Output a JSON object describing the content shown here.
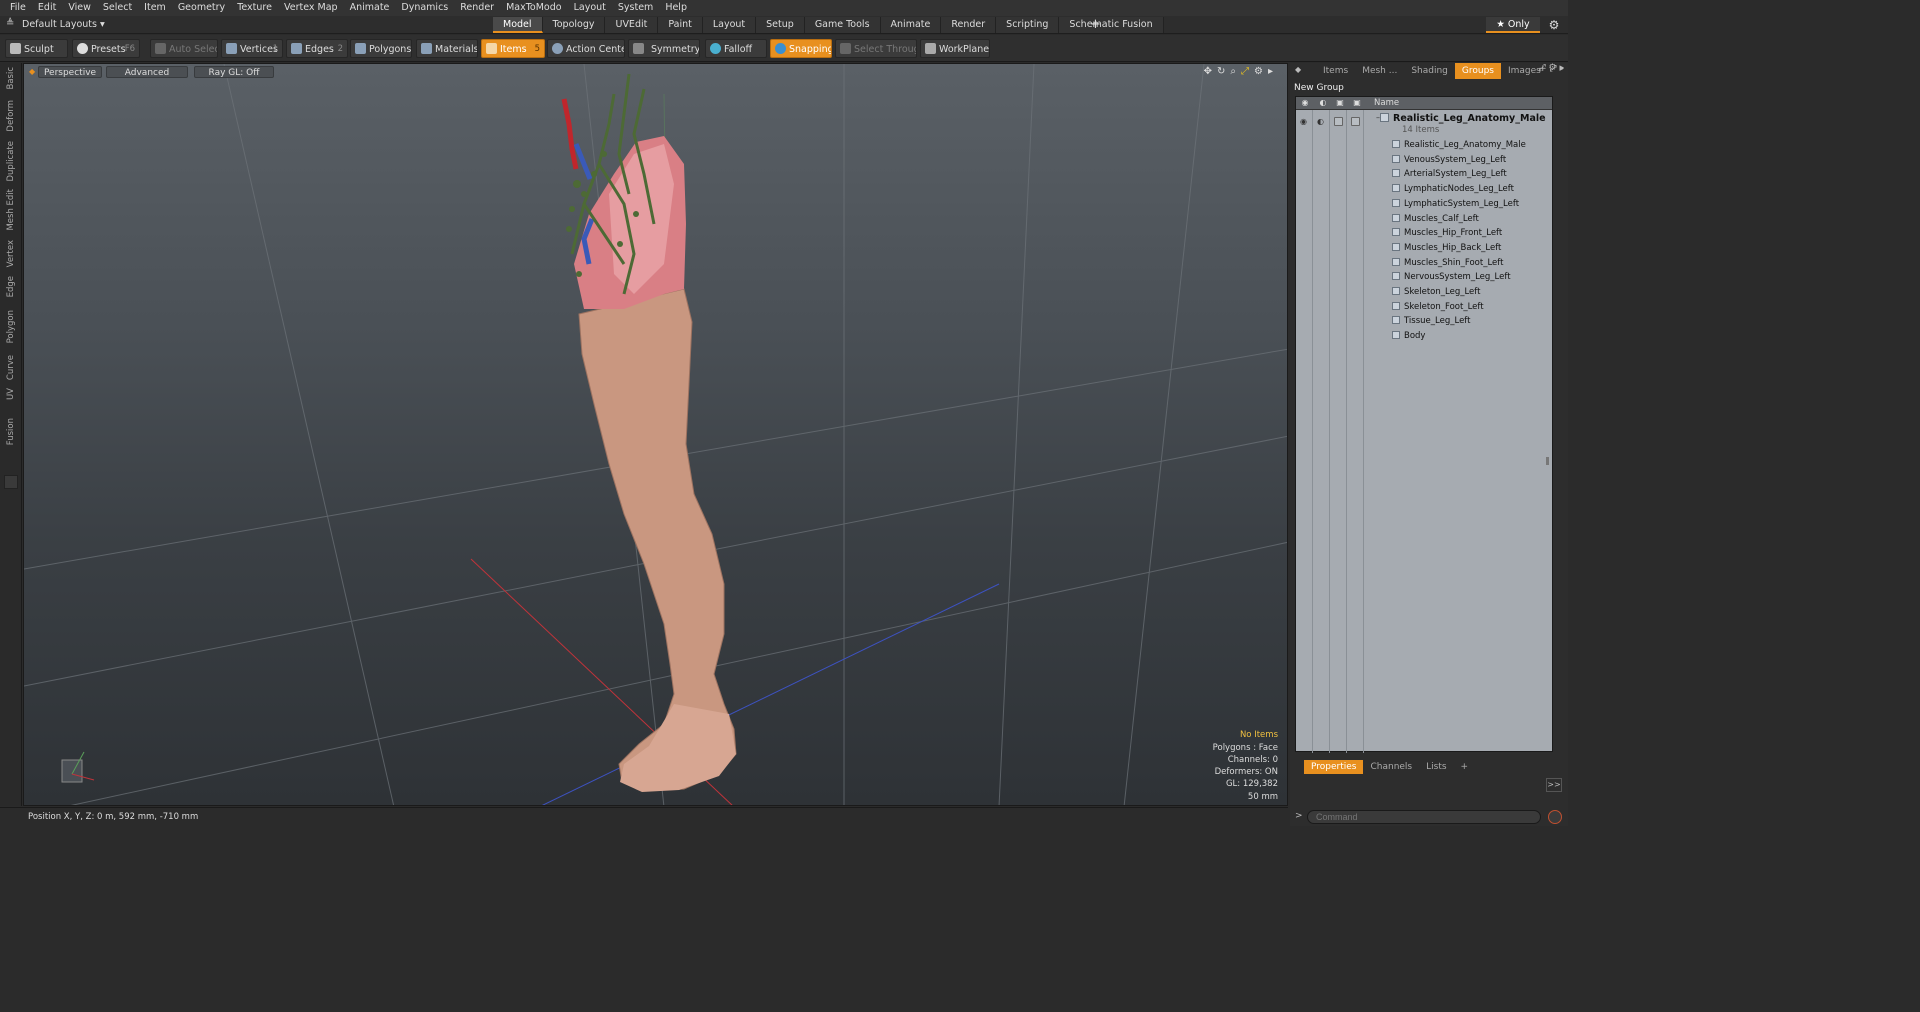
{
  "menu": [
    "File",
    "Edit",
    "View",
    "Select",
    "Item",
    "Geometry",
    "Texture",
    "Vertex Map",
    "Animate",
    "Dynamics",
    "Render",
    "MaxToModo",
    "Layout",
    "System",
    "Help"
  ],
  "layout_selector": "Default Layouts ▾",
  "layout_tabs": [
    "Model",
    "Topology",
    "UVEdit",
    "Paint",
    "Layout",
    "Setup",
    "Game Tools",
    "Animate",
    "Render",
    "Scripting",
    "Schematic Fusion"
  ],
  "layout_tab_active": "Model",
  "only_button": "★  Only",
  "toolbar": {
    "sculpt": "Sculpt",
    "presets": "Presets",
    "presets_key": "F6",
    "auto_select": "Auto Select",
    "vertices": "Vertices",
    "vertices_key": "1",
    "edges": "Edges",
    "edges_key": "2",
    "polygons": "Polygons",
    "materials": "Materials",
    "items": "Items",
    "items_key": "5",
    "action_center": "Action Center",
    "symmetry": "Symmetry",
    "falloff": "Falloff",
    "snapping": "Snapping",
    "select_through": "Select Through",
    "workplane": "WorkPlane"
  },
  "side_tabs": [
    "Basic",
    "Deform",
    "Duplicate",
    "Mesh Edit",
    "Vertex",
    "Edge",
    "Polygon",
    "Curve",
    "UV",
    "Fusion"
  ],
  "viewport": {
    "view_mode": "Perspective",
    "shading": "Advanced",
    "raygl": "Ray GL: Off",
    "info": {
      "items": "No Items",
      "polygons": "Polygons : Face",
      "channels": "Channels: 0",
      "deformers": "Deformers: ON",
      "gl": "GL: 129,382",
      "scale": "50 mm"
    }
  },
  "status": "Position X, Y, Z:   0 m, 592 mm, -710 mm",
  "right_panel": {
    "tabs": [
      "Items",
      "Mesh ...",
      "Shading",
      "Groups",
      "Images"
    ],
    "active_tab": "Groups",
    "new_group": "New Group",
    "column_name": "Name",
    "group_name": "Realistic_Leg_Anatomy_Male",
    "group_count": "14 Items",
    "items": [
      "Realistic_Leg_Anatomy_Male",
      "VenousSystem_Leg_Left",
      "ArterialSystem_Leg_Left",
      "LymphaticNodes_Leg_Left",
      "LymphaticSystem_Leg_Left",
      "Muscles_Calf_Left",
      "Muscles_Hip_Front_Left",
      "Muscles_Hip_Back_Left",
      "Muscles_Shin_Foot_Left",
      "NervousSystem_Leg_Left",
      "Skeleton_Leg_Left",
      "Skeleton_Foot_Left",
      "Tissue_Leg_Left",
      "Body"
    ],
    "bottom_tabs": [
      "Properties",
      "Channels",
      "Lists"
    ],
    "bottom_active": "Properties",
    "command_placeholder": "Command"
  },
  "colors": {
    "accent": "#e8901f",
    "viewport_top": "#5a6066",
    "viewport_bottom": "#2e3236",
    "skin": "#c99780",
    "muscle": "#d97f85",
    "artery": "#c0262c",
    "vein": "#3a5ab8",
    "nerve": "#4d6a35"
  }
}
